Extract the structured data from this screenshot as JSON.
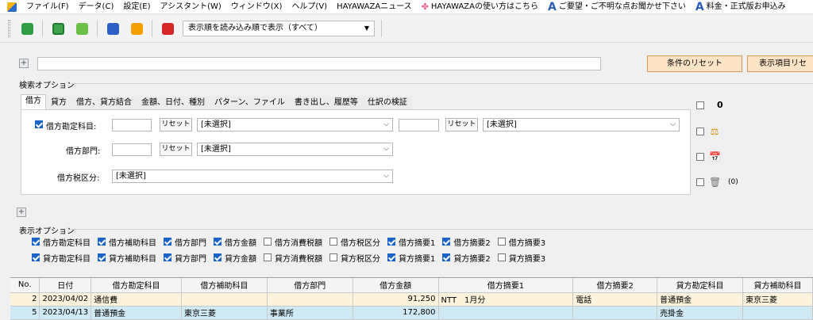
{
  "menu": {
    "items": [
      "ファイル(F)",
      "データ(C)",
      "設定(E)",
      "アシスタント(W)",
      "ウィンドウ(X)",
      "ヘルプ(V)",
      "HAYAWAZAニュース"
    ],
    "howto": "HAYAWAZAの使い方はこちら",
    "request": "ご要望・ご不明な点お聞かせ下さい",
    "pricing": "料金・正式版お申込み"
  },
  "toolbar": {
    "sort_select": "表示順を読み込み順で表示（すべて）"
  },
  "top": {
    "reset_conditions": "条件のリセット",
    "reset_display": "表示項目リセ"
  },
  "search_options": {
    "title": "検索オプション",
    "tabs": [
      "借方",
      "貸方",
      "借方、貸方結合",
      "金額、日付、種別",
      "パターン、ファイル",
      "書き出し、履歴等",
      "仕訳の検証"
    ],
    "debit_account_label": "借方勘定科目:",
    "debit_dept_label": "借方部門:",
    "debit_tax_label": "借方税区分:",
    "reset": "リセット",
    "unselected": "[未選択]"
  },
  "side": {
    "count": "0",
    "trash_count": "(0)"
  },
  "display_options": {
    "title": "表示オプション",
    "row1": [
      {
        "label": "借方勘定科目",
        "checked": true
      },
      {
        "label": "借方補助科目",
        "checked": true
      },
      {
        "label": "借方部門",
        "checked": true
      },
      {
        "label": "借方金額",
        "checked": true
      },
      {
        "label": "借方消費税額",
        "checked": false
      },
      {
        "label": "借方税区分",
        "checked": false
      },
      {
        "label": "借方摘要1",
        "checked": true
      },
      {
        "label": "借方摘要2",
        "checked": true
      },
      {
        "label": "借方摘要3",
        "checked": false
      }
    ],
    "row2": [
      {
        "label": "貸方勘定科目",
        "checked": true
      },
      {
        "label": "貸方補助科目",
        "checked": true
      },
      {
        "label": "貸方部門",
        "checked": true
      },
      {
        "label": "貸方金額",
        "checked": true
      },
      {
        "label": "貸方消費税額",
        "checked": false
      },
      {
        "label": "貸方税区分",
        "checked": false
      },
      {
        "label": "貸方摘要1",
        "checked": true
      },
      {
        "label": "貸方摘要2",
        "checked": true
      },
      {
        "label": "貸方摘要3",
        "checked": false
      }
    ]
  },
  "grid": {
    "columns": [
      "No.",
      "日付",
      "借方勘定科目",
      "借方補助科目",
      "借方部門",
      "借方金額",
      "借方摘要1",
      "借方摘要2",
      "貸方勘定科目",
      "貸方補助科目"
    ],
    "rows": [
      [
        "2",
        "2023/04/02",
        "通信費",
        "",
        "",
        "91,250",
        "NTT　1月分",
        "電話",
        "普通預金",
        "東京三菱"
      ],
      [
        "5",
        "2023/04/13",
        "普通預金",
        "東京三菱",
        "事業所",
        "172,800",
        "",
        "",
        "売掛金",
        ""
      ]
    ]
  },
  "colors": {
    "accent": "#1a64c8",
    "row_a": "#fdf3dc",
    "row_b": "#cfe9f5",
    "button_orange": "#fde4c7"
  }
}
